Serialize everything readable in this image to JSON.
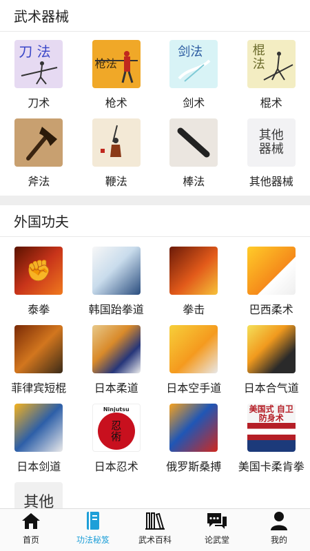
{
  "weapons_section": {
    "title": "武术器械",
    "items": [
      {
        "label": "刀术",
        "art": "刀 法"
      },
      {
        "label": "枪术",
        "art": "枪法"
      },
      {
        "label": "剑术",
        "art": "剑法"
      },
      {
        "label": "棍术",
        "art": "棍 法"
      },
      {
        "label": "斧法",
        "art": ""
      },
      {
        "label": "鞭法",
        "art": ""
      },
      {
        "label": "棒法",
        "art": ""
      },
      {
        "label": "其他器械",
        "art": "其他 器械"
      }
    ]
  },
  "foreign_section": {
    "title": "外国功夫",
    "items": [
      {
        "label": "泰拳"
      },
      {
        "label": "韩国跆拳道"
      },
      {
        "label": "拳击"
      },
      {
        "label": "巴西柔术"
      },
      {
        "label": "菲律宾短棍"
      },
      {
        "label": "日本柔道"
      },
      {
        "label": "日本空手道"
      },
      {
        "label": "日本合气道"
      },
      {
        "label": "日本剑道"
      },
      {
        "label": "日本忍术",
        "art_top": "Ninjutsu",
        "art": "忍 術"
      },
      {
        "label": "俄罗斯桑搏"
      },
      {
        "label": "美国卡柔肯拳",
        "art": "美国式 自卫防身术"
      },
      {
        "label": "",
        "art": "其他"
      }
    ]
  },
  "tabbar": {
    "tabs": [
      {
        "label": "首页",
        "icon": "home-icon"
      },
      {
        "label": "功法秘笈",
        "icon": "book-icon",
        "active": true
      },
      {
        "label": "武术百科",
        "icon": "books-icon"
      },
      {
        "label": "论武堂",
        "icon": "chat-icon"
      },
      {
        "label": "我的",
        "icon": "user-icon"
      }
    ],
    "active_color": "#1e9fd8"
  }
}
